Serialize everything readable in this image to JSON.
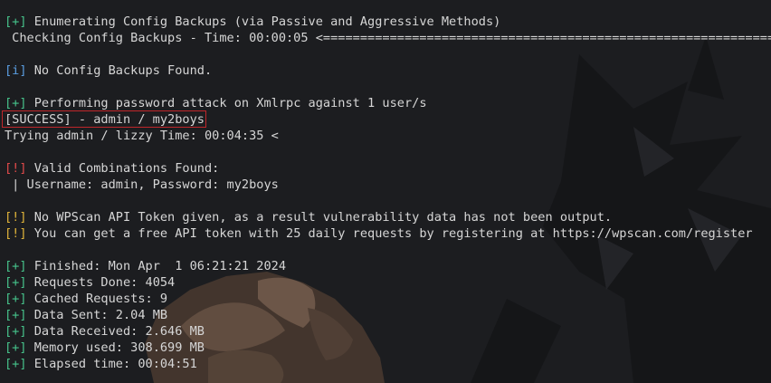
{
  "colors": {
    "background": "#1c1d20",
    "text": "#d6d6d6",
    "plus": "#46c28a",
    "info": "#5a9de0",
    "error": "#e04a4a",
    "warning": "#e0b43a",
    "highlight_border": "#c0262a"
  },
  "lines": [
    {
      "tag": "+",
      "text": " Enumerating Config Backups (via Passive and Aggressive Methods)"
    },
    {
      "tag": "",
      "text": " Checking Config Backups - Time: 00:00:05 <================================================================================"
    },
    {
      "tag": "i",
      "text": " No Config Backups Found."
    },
    {
      "tag": "+",
      "text": " Performing password attack on Xmlrpc against 1 user/s"
    },
    {
      "tag": "",
      "text": "[SUCCESS] - admin / my2boys"
    },
    {
      "tag": "",
      "text": "Trying admin / lizzy Time: 00:04:35 <"
    },
    {
      "tag": "!",
      "text": " Valid Combinations Found:"
    },
    {
      "tag": "",
      "text": " | Username: admin, Password: my2boys"
    },
    {
      "tag": "!w",
      "text": " No WPScan API Token given, as a result vulnerability data has not been output."
    },
    {
      "tag": "!w",
      "text": " You can get a free API token with 25 daily requests by registering at https://wpscan.com/register"
    },
    {
      "tag": "+",
      "text": " Finished: Mon Apr  1 06:21:21 2024"
    },
    {
      "tag": "+",
      "text": " Requests Done: 4054"
    },
    {
      "tag": "+",
      "text": " Cached Requests: 9"
    },
    {
      "tag": "+",
      "text": " Data Sent: 2.04 MB"
    },
    {
      "tag": "+",
      "text": " Data Received: 2.646 MB"
    },
    {
      "tag": "+",
      "text": " Memory used: 308.699 MB"
    },
    {
      "tag": "+",
      "text": " Elapsed time: 00:04:51"
    }
  ],
  "tags": {
    "plus": "[+]",
    "info": "[i]",
    "error": "[!]",
    "warning": "[!]"
  }
}
